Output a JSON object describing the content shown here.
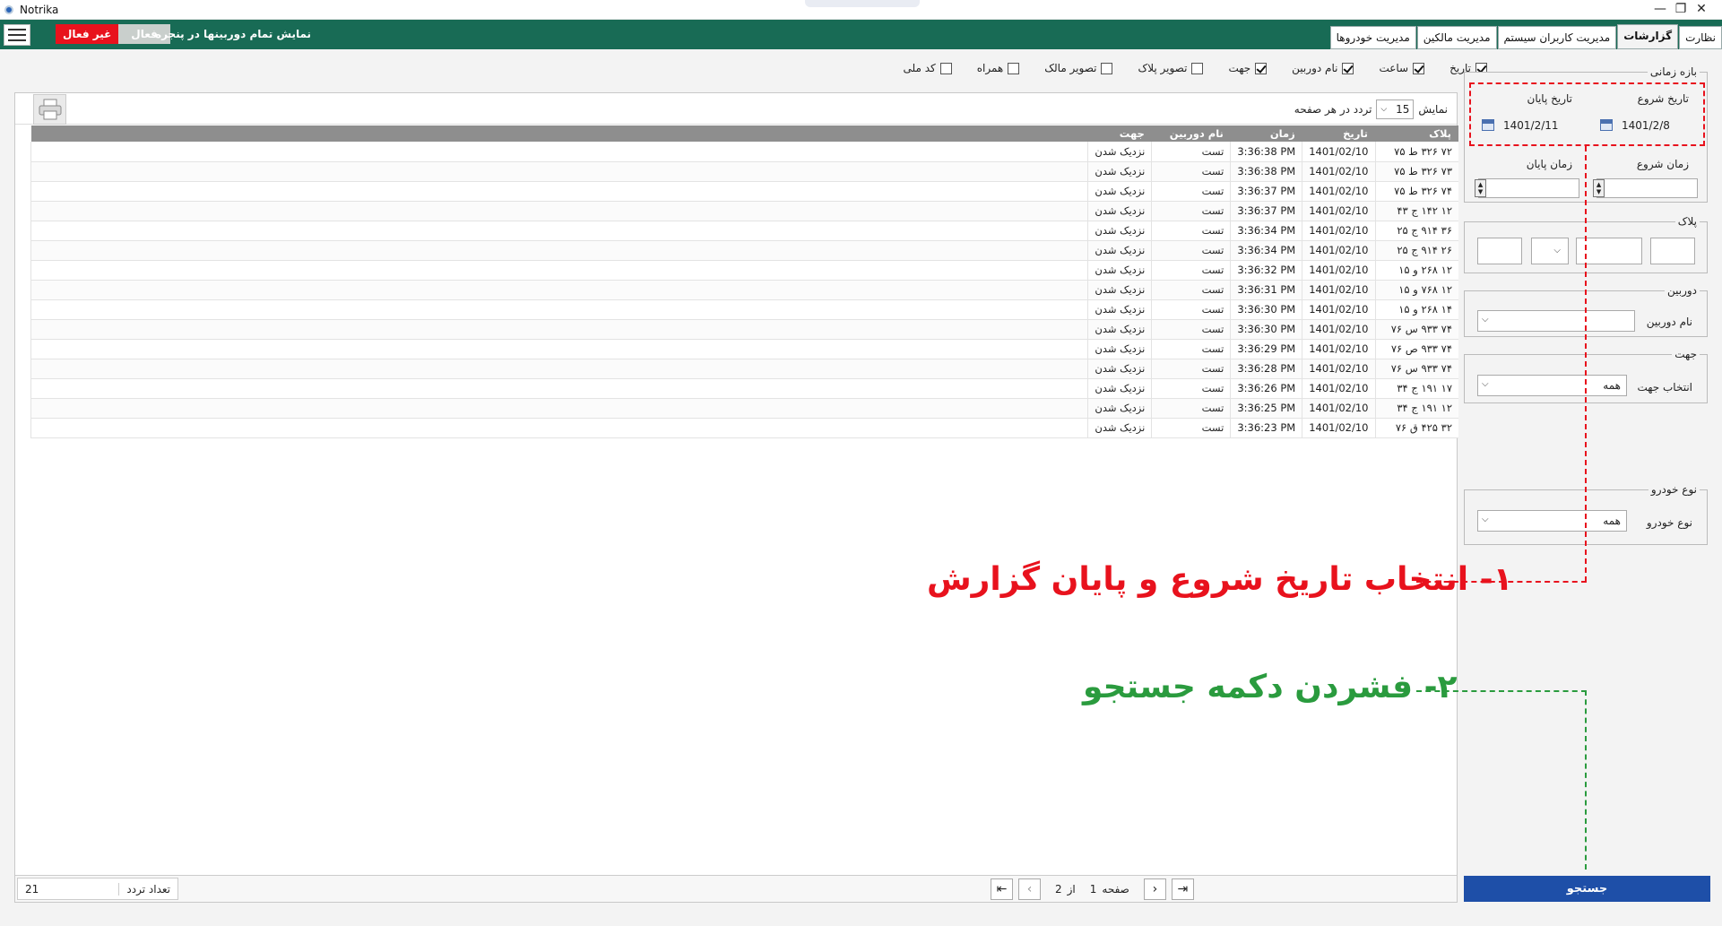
{
  "window": {
    "title": "Notrika",
    "minimize": "—",
    "restore": "❐",
    "close": "✕"
  },
  "header": {
    "toggle_off": "غیر فعال",
    "toggle_on": "فعال",
    "show_all": "نمایش تمام دوربینها در پنجره"
  },
  "tabs": [
    "نظارت",
    "گزارشات",
    "مدیریت کاربران سیستم",
    "مدیریت مالکین",
    "مدیریت خودروها"
  ],
  "active_tab": "گزارشات",
  "columns_filter": [
    {
      "label": "تاریخ",
      "checked": true
    },
    {
      "label": "ساعت",
      "checked": true
    },
    {
      "label": "نام دوربین",
      "checked": true
    },
    {
      "label": "جهت",
      "checked": true
    },
    {
      "label": "تصویر پلاک",
      "checked": false
    },
    {
      "label": "تصویر مالک",
      "checked": false
    },
    {
      "label": "همراه",
      "checked": false
    },
    {
      "label": "کد ملی",
      "checked": false
    }
  ],
  "grid": {
    "show_label": "نمایش",
    "page_size": "15",
    "per_page_label": "تردد در هر صفحه",
    "headers": [
      "پلاک",
      "تاریخ",
      "زمان",
      "نام دوربین",
      "جهت"
    ],
    "rows": [
      [
        "۷۲ ۳۲۶ ط ۷۵",
        "1401/02/10",
        "3:36:38 PM",
        "تست",
        "نزدیک شدن"
      ],
      [
        "۷۳ ۳۲۶ ط ۷۵",
        "1401/02/10",
        "3:36:38 PM",
        "تست",
        "نزدیک شدن"
      ],
      [
        "۷۴ ۳۲۶ ط ۷۵",
        "1401/02/10",
        "3:36:37 PM",
        "تست",
        "نزدیک شدن"
      ],
      [
        "۱۲ ۱۴۲ ج ۴۳",
        "1401/02/10",
        "3:36:37 PM",
        "تست",
        "نزدیک شدن"
      ],
      [
        "۳۶ ۹۱۴ ج ۲۵",
        "1401/02/10",
        "3:36:34 PM",
        "تست",
        "نزدیک شدن"
      ],
      [
        "۲۶ ۹۱۴ ج ۲۵",
        "1401/02/10",
        "3:36:34 PM",
        "تست",
        "نزدیک شدن"
      ],
      [
        "۱۲ ۲۶۸ و ۱۵",
        "1401/02/10",
        "3:36:32 PM",
        "تست",
        "نزدیک شدن"
      ],
      [
        "۱۲ ۷۶۸ و ۱۵",
        "1401/02/10",
        "3:36:31 PM",
        "تست",
        "نزدیک شدن"
      ],
      [
        "۱۴ ۲۶۸ و ۱۵",
        "1401/02/10",
        "3:36:30 PM",
        "تست",
        "نزدیک شدن"
      ],
      [
        "۷۴ ۹۳۳ س ۷۶",
        "1401/02/10",
        "3:36:30 PM",
        "تست",
        "نزدیک شدن"
      ],
      [
        "۷۴ ۹۳۳ ص ۷۶",
        "1401/02/10",
        "3:36:29 PM",
        "تست",
        "نزدیک شدن"
      ],
      [
        "۷۴ ۹۳۳ س ۷۶",
        "1401/02/10",
        "3:36:28 PM",
        "تست",
        "نزدیک شدن"
      ],
      [
        "۱۷ ۱۹۱ ج ۳۴",
        "1401/02/10",
        "3:36:26 PM",
        "تست",
        "نزدیک شدن"
      ],
      [
        "۱۲ ۱۹۱ ج ۳۴",
        "1401/02/10",
        "3:36:25 PM",
        "تست",
        "نزدیک شدن"
      ],
      [
        "۳۲ ۴۲۵ ق ۷۶",
        "1401/02/10",
        "3:36:23 PM",
        "تست",
        "نزدیک شدن"
      ]
    ],
    "count_label": "تعداد تردد",
    "count_value": "21",
    "page_label": "صفحه",
    "page_current": "1",
    "of_label": "از",
    "page_total": "2"
  },
  "filters": {
    "time_range": {
      "legend": "بازه زمانی",
      "start_date_label": "تاریخ شروع",
      "end_date_label": "تاریخ پایان",
      "start_date": "1401/2/8",
      "end_date": "1401/2/11",
      "start_time_label": "زمان شروع",
      "end_time_label": "زمان پایان"
    },
    "plate": {
      "legend": "پلاک"
    },
    "camera": {
      "legend": "دوربین",
      "label": "نام دوربین",
      "value": ""
    },
    "direction": {
      "legend": "جهت",
      "label": "انتخاب جهت",
      "value": "همه"
    },
    "vehicle": {
      "legend": "نوع خودرو",
      "label": "نوع خودرو",
      "value": "همه"
    }
  },
  "search_button": "جستجو",
  "annotations": {
    "step1": "۱- انتخاب تاریخ شروع و پایان گزارش",
    "step2": "۲- فشردن دکمه جستجو",
    "step1_color": "#e8121d",
    "step2_color": "#2a9b3e"
  },
  "colors": {
    "header_green": "#186b55",
    "search_blue": "#1e4fa8",
    "inactive_red": "#e8121d"
  }
}
